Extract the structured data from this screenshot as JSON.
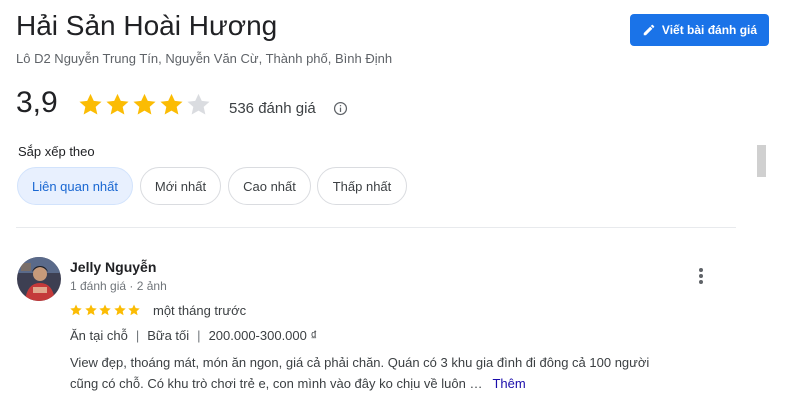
{
  "place": {
    "title": "Hải Sản Hoài Hương",
    "address": "Lô D2 Nguyễn Trung Tín, Nguyễn Văn Cừ, Thành phố, Bình Định"
  },
  "write_review_button": {
    "label": "Viết bài đánh giá",
    "icon": "pencil-icon"
  },
  "rating": {
    "value": "3,9",
    "stars_filled": 4,
    "stars_total": 5,
    "count_label": "536 đánh giá"
  },
  "sort": {
    "label": "Sắp xếp theo",
    "options": [
      "Liên quan nhất",
      "Mới nhất",
      "Cao nhất",
      "Thấp nhất"
    ],
    "selected": "Liên quan nhất"
  },
  "review": {
    "author": "Jelly Nguyễn",
    "meta": "1 đánh giá · 2 ảnh",
    "stars": 5,
    "time": "một tháng trước",
    "tags": [
      "Ăn tại chỗ",
      "Bữa tối",
      "200.000-300.000 ₫"
    ],
    "text_lines": [
      "View đẹp, thoáng mát, món ăn ngon, giá cả phải chăn. Quán có 3 khu gia đình đi đông cả 100 người",
      "cũng có chỗ. Có khu trò chơi trẻ e, con mình vào đây ko chịu về luôn …"
    ],
    "more_label": "Thêm"
  },
  "colors": {
    "star": "#fbbc04",
    "star_empty": "#dadce0",
    "primary": "#1a73e8",
    "chip_active_bg": "#e8f0fe"
  }
}
